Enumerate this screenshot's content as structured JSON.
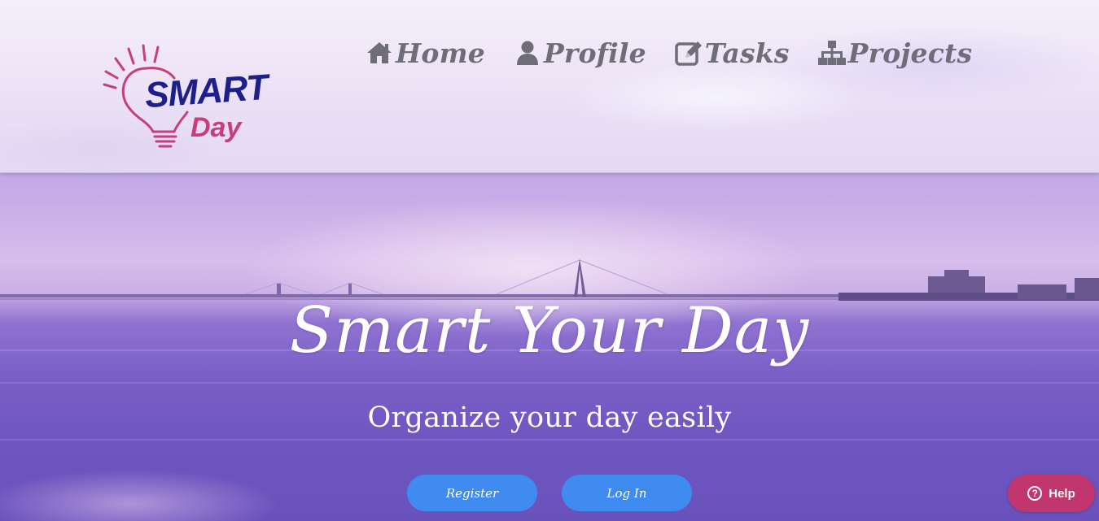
{
  "app": {
    "logo_text_top": "SMART",
    "logo_text_bottom": "Day"
  },
  "nav": {
    "items": [
      {
        "label": "Home",
        "icon": "home-icon"
      },
      {
        "label": "Profile",
        "icon": "user-icon"
      },
      {
        "label": "Tasks",
        "icon": "edit-icon"
      },
      {
        "label": "Projects",
        "icon": "sitemap-icon"
      }
    ]
  },
  "hero": {
    "title": "Smart Your Day",
    "subtitle": "Organize your day easily"
  },
  "actions": {
    "register_label": "Register",
    "login_label": "Log In"
  },
  "help": {
    "label": "Help",
    "icon": "question-circle-icon"
  },
  "colors": {
    "nav_text": "#6f6d78",
    "button_blue": "#3f8bf0",
    "help_pink": "#c2366f",
    "logo_navy": "#1d1f8a",
    "logo_pink": "#c73d7e"
  }
}
